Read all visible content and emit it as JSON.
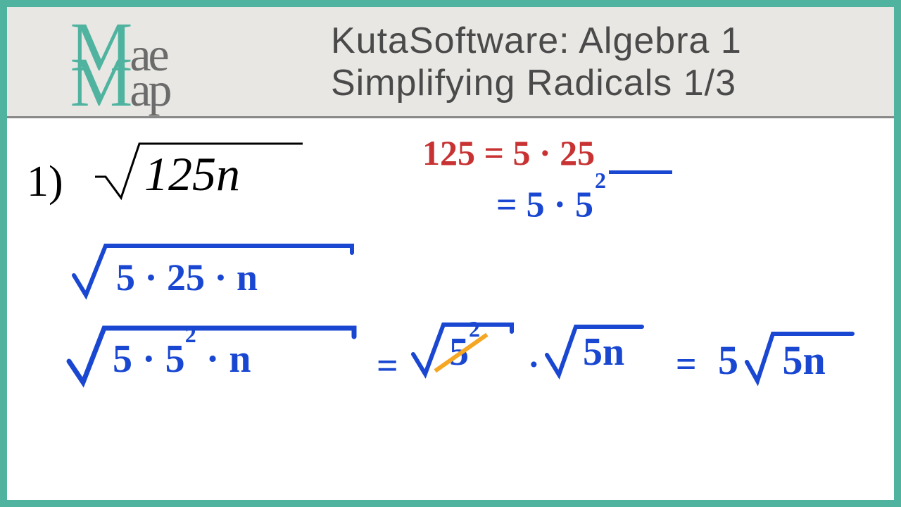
{
  "logo": {
    "l1big": "M",
    "l1small": "ae",
    "l2big": "M",
    "l2small": "ap"
  },
  "header": {
    "line1": "KutaSoftware: Algebra 1",
    "line2": "Simplifying Radicals 1/3"
  },
  "problem": {
    "number": "1)",
    "radicand": "125",
    "variable": "n"
  },
  "work": {
    "red_factor": "125 = 5 · 25",
    "blue_eq": "= 5 · 5",
    "blue_exp1": "2",
    "step1a": "5 · 25 · n",
    "step1b": "5 · 5",
    "step1b_exp": "2",
    "step1b_tail": " · n",
    "mid_eq": "=",
    "sq_root_5sq": "5",
    "sq_root_5sq_exp": "2",
    "dot": "·",
    "sq_root_5n": "5n",
    "eq2": "=",
    "final_coeff": "5",
    "final_radicand": "5n"
  }
}
